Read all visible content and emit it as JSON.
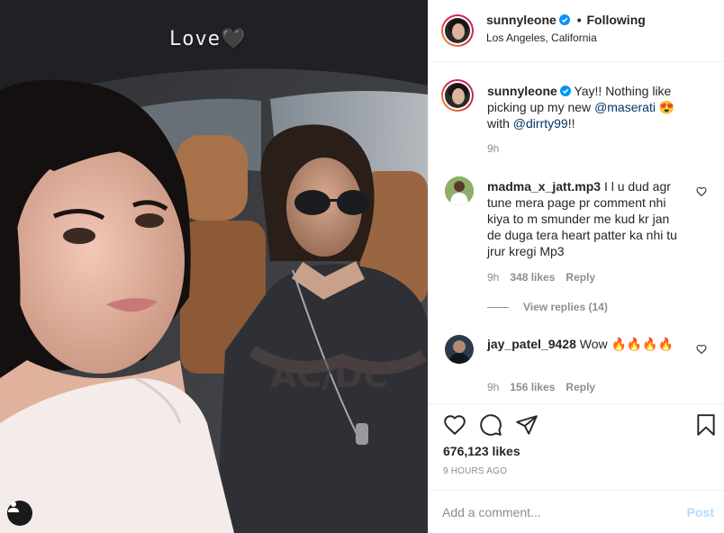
{
  "photo": {
    "overlay_text": "Love🖤",
    "user_tag_icon": "person-icon"
  },
  "header": {
    "username": "sunnyleone",
    "separator": "•",
    "follow_status": "Following",
    "location": "Los Angeles, California"
  },
  "caption": {
    "username": "sunnyleone",
    "text_before": "Yay!! Nothing like picking up my new ",
    "mention_1": "@maserati",
    "text_middle": " 😍 with ",
    "mention_2": "@dirrty99",
    "text_after": "!!",
    "time": "9h"
  },
  "comments": [
    {
      "username": "madma_x_jatt.mp3",
      "text": "I l u dud agr tune mera page pr comment nhi kiya to m smunder me kud kr jan de duga tera heart patter ka nhi tu jrur kregi Mp3",
      "time": "9h",
      "likes": "348 likes",
      "reply_label": "Reply",
      "view_replies": "View replies (14)"
    },
    {
      "username": "jay_patel_9428",
      "text": "Wow 🔥🔥🔥🔥",
      "time": "9h",
      "likes": "156 likes",
      "reply_label": "Reply"
    }
  ],
  "actions": {
    "like_icon": "heart-icon",
    "comment_icon": "comment-icon",
    "share_icon": "share-icon",
    "save_icon": "bookmark-icon",
    "likes_count": "676,123 likes",
    "post_time": "9 HOURS AGO"
  },
  "add_comment": {
    "placeholder": "Add a comment...",
    "post_label": "Post"
  },
  "colors": {
    "verified_blue": "#0095f6",
    "link_blue": "#00376b",
    "post_disabled": "#b3dbff",
    "muted_text": "#8e8e8e"
  }
}
